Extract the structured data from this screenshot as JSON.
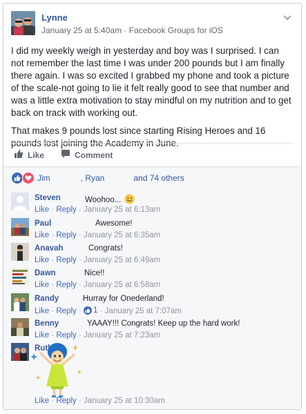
{
  "post": {
    "author": "Lynne",
    "timestamp": "January 25 at 5:40am",
    "source": "Facebook Groups for iOS",
    "paragraphs": [
      "I did my weekly weigh in yesterday and boy was I surprised. I can not remember the last time I was under 200 pounds but I am finally there again. I was so excited I grabbed my phone and took a picture of the scale-not going to lie it felt really good to see that number and was a little extra motivation to stay mindful on my nutrition and to get back on track with working out.",
      "That makes 9 pounds lost since starting Rising Heroes and 16 pounds lost joining the Academy in June."
    ]
  },
  "actions": {
    "like": "Like",
    "comment": "Comment"
  },
  "reactions": {
    "name1": "Jim",
    "name2": ", Ryan",
    "others": "and 74 others"
  },
  "comment_actions": {
    "like": "Like",
    "reply": "Reply",
    "separator": "·"
  },
  "comments": [
    {
      "name": "Steven",
      "text": "Woohoo...",
      "time": "January 25 at 6:13am",
      "likes": ""
    },
    {
      "name": "Paul",
      "text": "Awesome!",
      "time": "January 25 at 6:35am",
      "likes": ""
    },
    {
      "name": "Anavah",
      "text": "Congrats!",
      "time": "January 25 at 6:49am",
      "likes": ""
    },
    {
      "name": "Dawn",
      "text": "Nice!!",
      "time": "January 25 at 6:58am",
      "likes": ""
    },
    {
      "name": "Randy",
      "text": "Hurray for Onederland!",
      "time": "January 25 at 7:07am",
      "likes": "1"
    },
    {
      "name": "Benny",
      "text": "YAAAY!!! Congrats! Keep up the hard work!",
      "time": "January 25 at 7:23am",
      "likes": ""
    },
    {
      "name": "Ruth",
      "text": "",
      "time": "January 25 at 10:30am",
      "likes": ""
    }
  ],
  "dawn_avatar_text": "SIMPLE DREAM BIG BE GRATEFUL GIVE LOVE LAUGH LOTS",
  "colors": {
    "link": "#365899",
    "meta": "#616770",
    "comment_bg": "#f6f7f9",
    "like_blue": "#4267b2",
    "love_red": "#f25268"
  },
  "icons": [
    "chevron-down-icon",
    "thumbs-up-icon",
    "comment-icon",
    "like-reaction-icon",
    "love-reaction-icon",
    "smiley-emoji-icon",
    "joy-sticker"
  ]
}
